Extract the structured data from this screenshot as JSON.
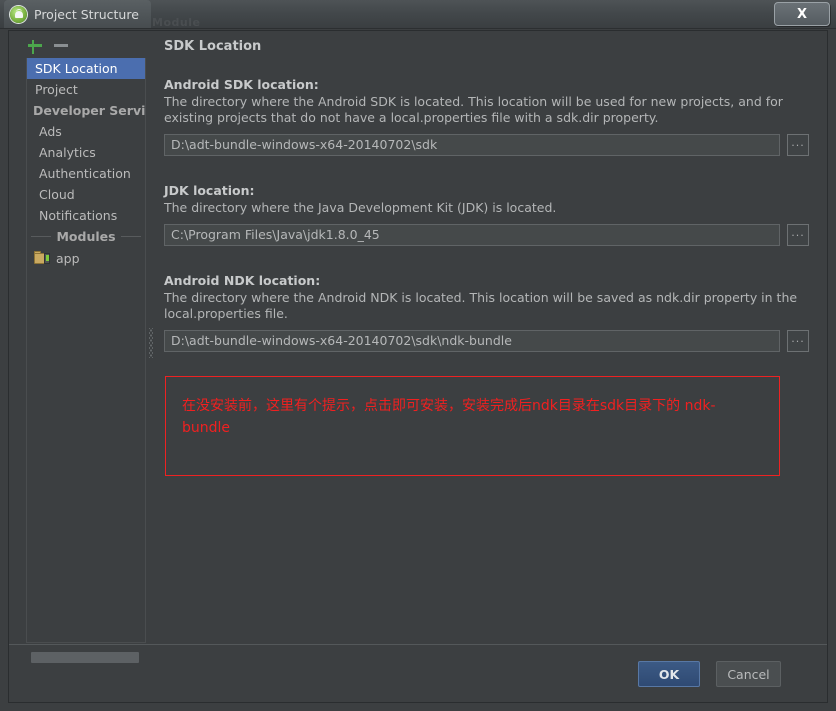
{
  "window": {
    "title": "Project Structure",
    "app_icon": "android-studio-icon",
    "ghost_label": "Module",
    "close_label": "X"
  },
  "sidebar": {
    "add_label": "+",
    "remove_label": "−",
    "items": [
      {
        "label": "SDK Location",
        "selected": true,
        "type": "item"
      },
      {
        "label": "Project",
        "selected": false,
        "type": "item"
      },
      {
        "label": "Developer Services",
        "selected": false,
        "type": "group"
      },
      {
        "label": "Ads",
        "selected": false,
        "type": "child"
      },
      {
        "label": "Analytics",
        "selected": false,
        "type": "child"
      },
      {
        "label": "Authentication",
        "selected": false,
        "type": "child"
      },
      {
        "label": "Cloud",
        "selected": false,
        "type": "child"
      },
      {
        "label": "Notifications",
        "selected": false,
        "type": "child"
      }
    ],
    "modules_separator": "Modules",
    "modules": [
      {
        "label": "app",
        "icon": "module-folder-icon"
      }
    ]
  },
  "main": {
    "title": "SDK Location",
    "sections": [
      {
        "label": "Android SDK location:",
        "description": "The directory where the Android SDK is located. This location will be used for new projects, and for existing projects that do not have a local.properties file with a sdk.dir property.",
        "value": "D:\\adt-bundle-windows-x64-20140702\\sdk",
        "browse_label": "..."
      },
      {
        "label": "JDK location:",
        "description": "The directory where the Java Development Kit (JDK) is located.",
        "value": "C:\\Program Files\\Java\\jdk1.8.0_45",
        "browse_label": "..."
      },
      {
        "label": "Android NDK location:",
        "description": "The directory where the Android NDK is located. This location will be saved as ndk.dir property in the local.properties file.",
        "value": "D:\\adt-bundle-windows-x64-20140702\\sdk\\ndk-bundle",
        "browse_label": "..."
      }
    ],
    "annotation": {
      "text": "在没安装前，这里有个提示，点击即可安装，安装完成后ndk目录在sdk目录下的 ndk-bundle",
      "color": "#f02020"
    }
  },
  "footer": {
    "ok_label": "OK",
    "cancel_label": "Cancel"
  },
  "colors": {
    "background": "#3c3f41",
    "selection": "#4b6eaf",
    "accent_green": "#4ca64c",
    "annotation_red": "#ee2222"
  }
}
